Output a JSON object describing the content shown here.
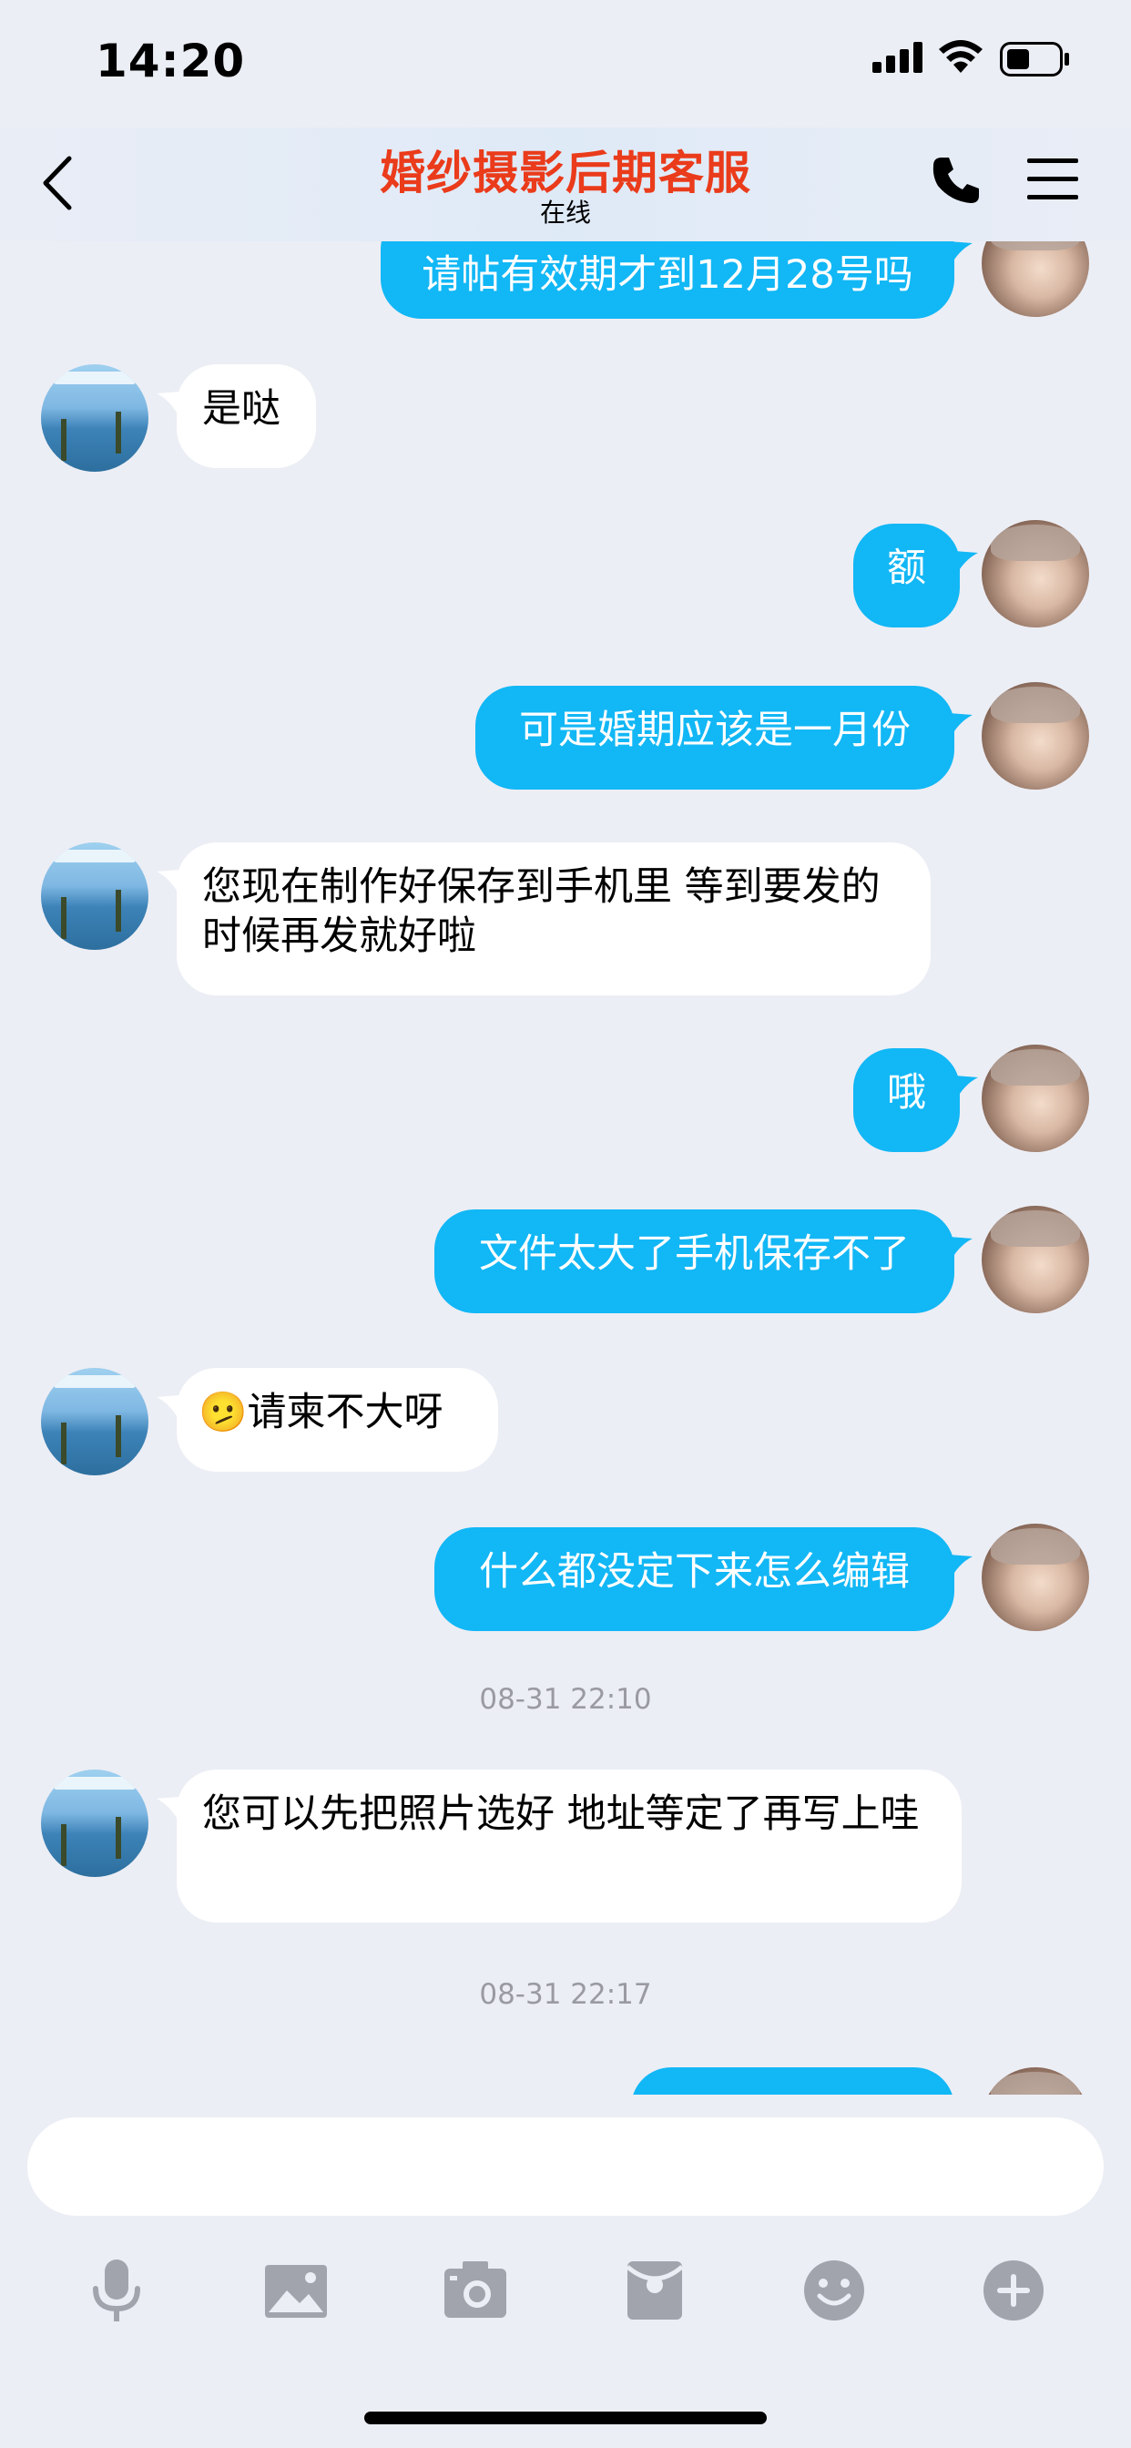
{
  "status_bar": {
    "time": "14:20"
  },
  "header": {
    "title": "婚纱摄影后期客服",
    "status": "在线"
  },
  "messages": [
    {
      "text": "请帖有效期才到12月28号吗"
    },
    {
      "text": "是哒"
    },
    {
      "text": "额"
    },
    {
      "text": "可是婚期应该是一月份"
    },
    {
      "text": "您现在制作好保存到手机里  等到要发的时候再发就好啦"
    },
    {
      "text": "哦"
    },
    {
      "text": "文件太大了手机保存不了"
    },
    {
      "emoji": "🫤",
      "text": "请柬不大呀"
    },
    {
      "text": "什么都没定下来怎么编辑"
    },
    {
      "timestamp": "08-31 22:10"
    },
    {
      "text": "您可以先把照片选好 地址等定了再写上哇"
    },
    {
      "timestamp": "08-31 22:17"
    }
  ],
  "input": {
    "value": ""
  },
  "colors": {
    "outgoing": "#12b7f5",
    "incoming": "#ffffff",
    "title": "#ea3b1b"
  }
}
